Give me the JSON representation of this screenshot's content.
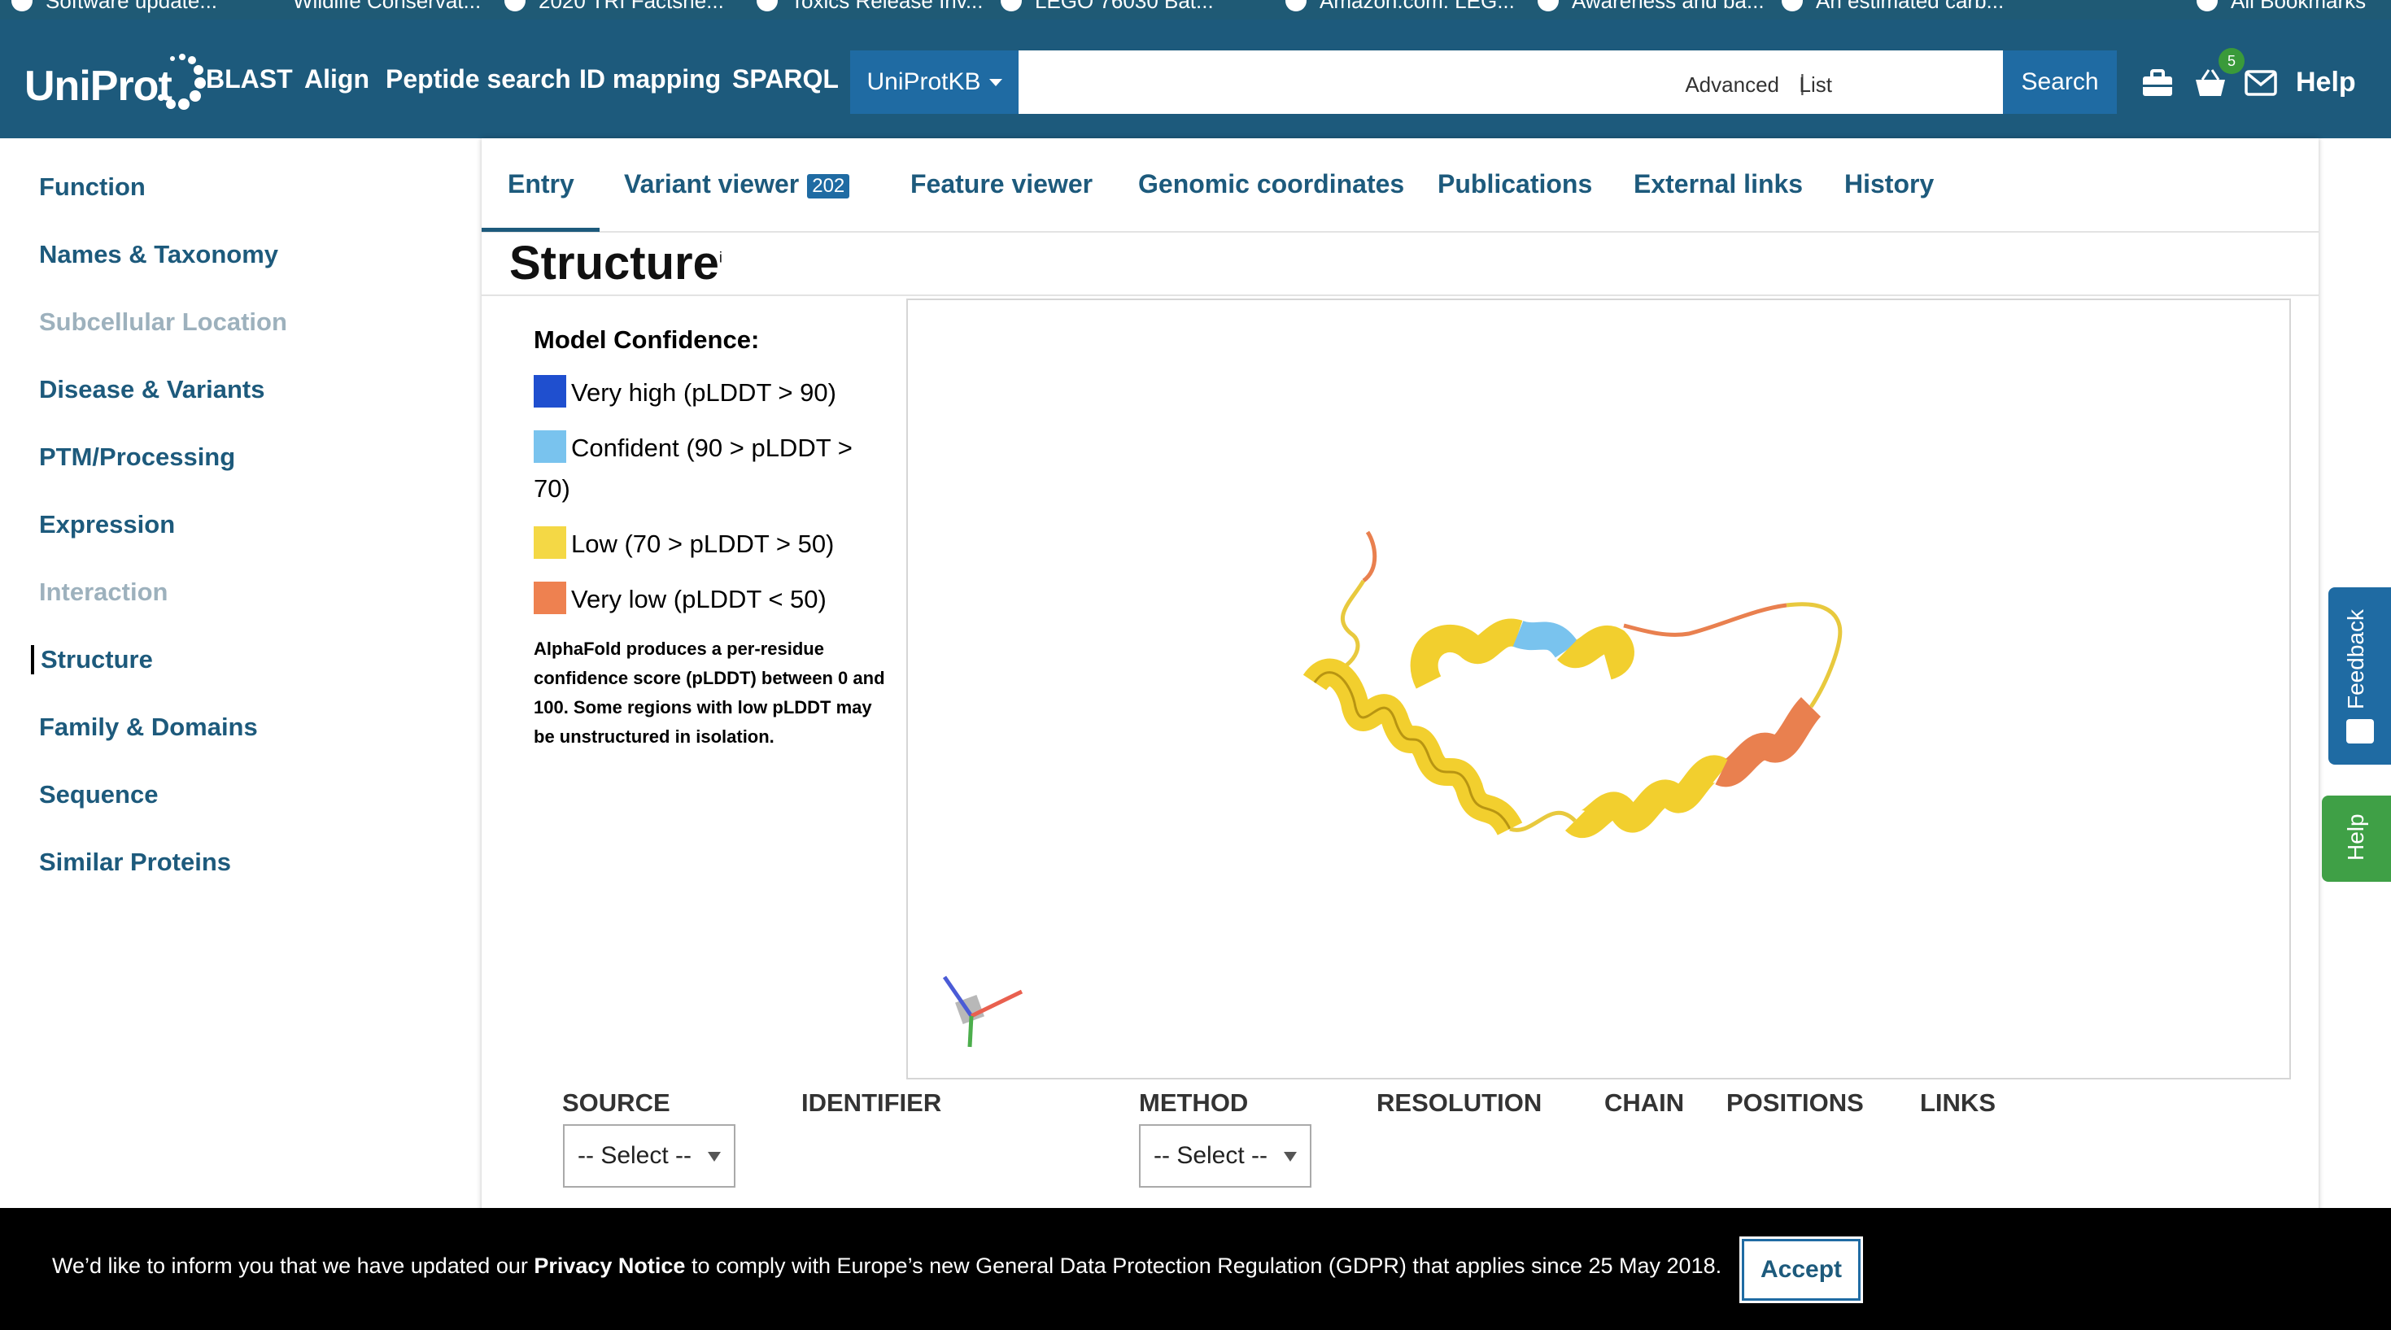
{
  "bookmarks": [
    "Software update...",
    "Wildlife Conservat...",
    "2020 TRI Factshe...",
    "Toxics Release Inv...",
    "LEGO 76030 Bat...",
    "Amazon.com: LEG...",
    "Awareness and ba...",
    "An estimated carb...",
    "All Bookmarks"
  ],
  "header": {
    "logo": "UniProt",
    "nav": [
      "BLAST",
      "Align",
      "Peptide search",
      "ID mapping",
      "SPARQL"
    ],
    "db_select": "UniProtKB",
    "search_placeholder": "",
    "advanced": "Advanced",
    "separator": "|",
    "list": "List",
    "search_button": "Search",
    "basket_count": "5",
    "help": "Help"
  },
  "sidebar": {
    "items": [
      {
        "label": "Function",
        "state": "normal"
      },
      {
        "label": "Names & Taxonomy",
        "state": "normal"
      },
      {
        "label": "Subcellular Location",
        "state": "disabled"
      },
      {
        "label": "Disease & Variants",
        "state": "normal"
      },
      {
        "label": "PTM/Processing",
        "state": "normal"
      },
      {
        "label": "Expression",
        "state": "normal"
      },
      {
        "label": "Interaction",
        "state": "disabled"
      },
      {
        "label": "Structure",
        "state": "active"
      },
      {
        "label": "Family & Domains",
        "state": "normal"
      },
      {
        "label": "Sequence",
        "state": "normal"
      },
      {
        "label": "Similar Proteins",
        "state": "normal"
      }
    ]
  },
  "tabs": {
    "entry": "Entry",
    "variant_viewer": "Variant viewer",
    "variant_count": "202",
    "feature_viewer": "Feature viewer",
    "genomic_coordinates": "Genomic coordinates",
    "publications": "Publications",
    "external_links": "External links",
    "history": "History"
  },
  "section": {
    "title": "Structure",
    "info": "i"
  },
  "legend": {
    "heading": "Model Confidence:",
    "rows": [
      {
        "label": "Very high (pLDDT > 90)",
        "color": "#1f4fcf"
      },
      {
        "label": "Confident (90 > pLDDT > 70)",
        "color": "#79c3ee"
      },
      {
        "label": "Low (70 > pLDDT > 50)",
        "color": "#f4d845"
      },
      {
        "label": "Very low (pLDDT < 50)",
        "color": "#ee8150"
      }
    ],
    "note": "AlphaFold produces a per-residue confidence score (pLDDT) between 0 and 100. Some regions with low pLDDT may be unstructured in isolation."
  },
  "table": {
    "columns": [
      "SOURCE",
      "IDENTIFIER",
      "METHOD",
      "RESOLUTION",
      "CHAIN",
      "POSITIONS",
      "LINKS"
    ],
    "source_select": "-- Select --",
    "method_select": "-- Select --"
  },
  "floating": {
    "feedback": "Feedback",
    "help": "Help"
  },
  "cookie": {
    "text_before": "We’d like to inform you that we have updated our ",
    "link": "Privacy Notice",
    "text_after": " to comply with Europe’s new General Data Protection Regulation (GDPR) that applies since 25 May 2018.",
    "accept": "Accept"
  }
}
